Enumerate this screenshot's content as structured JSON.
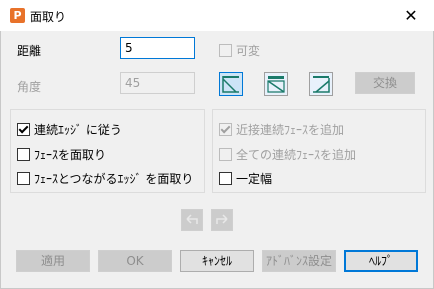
{
  "window": {
    "title": "面取り",
    "app_icon": "P",
    "close_label": "✕"
  },
  "distance": {
    "label": "距離",
    "value": "5"
  },
  "variable": {
    "label": "可変",
    "checked": false
  },
  "angle": {
    "label": "角度",
    "value": "45"
  },
  "exchange_button": "交換",
  "left_group": {
    "follow_connected_edges": {
      "label": "連続ｴｯｼﾞ に従う",
      "checked": true
    },
    "chamfer_faces": {
      "label": "ﾌｪｰｽを面取り",
      "checked": false
    },
    "chamfer_faces_and_connected_edges": {
      "label": "ﾌｪｰｽとつながるｴｯｼﾞ を面取り",
      "checked": false
    }
  },
  "right_group": {
    "add_nearby_connected_faces": {
      "label": "近接連続ﾌｪｰｽを追加",
      "checked": true
    },
    "add_all_connected_faces": {
      "label": "全ての連続ﾌｪｰｽを追加",
      "checked": false
    },
    "constant_width": {
      "label": "一定幅",
      "checked": false
    }
  },
  "footer": {
    "apply": "適用",
    "ok": "OK",
    "cancel": "ｷｬﾝｾﾙ",
    "advanced": "ｱﾄﾞﾊﾞﾝｽ設定",
    "help": "ﾍﾙﾌﾟ"
  },
  "colors": {
    "accent": "#0078d7",
    "app_icon": "#e8722a",
    "icon_line": "#1a7a6a"
  }
}
